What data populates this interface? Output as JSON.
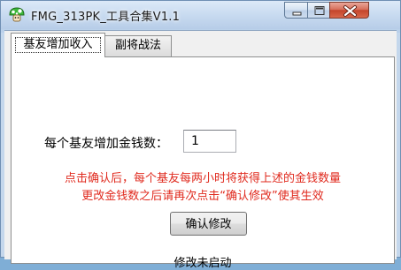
{
  "window": {
    "title": "FMG_313PK_工具合集V1.1",
    "icon": "mushroom-icon"
  },
  "tabs": [
    {
      "label": "基友增加收入",
      "active": true
    },
    {
      "label": "副将战法",
      "active": false
    }
  ],
  "form": {
    "money_label": "每个基友增加金钱数：",
    "money_value": "1"
  },
  "notice": {
    "line1": "点击确认后，每个基友每两小时将获得上述的金钱数量",
    "line2": "更改金钱数之后请再次点击“确认修改”使其生效",
    "color": "#e02a1e"
  },
  "confirm_button_label": "确认修改",
  "status_text": "修改未启动"
}
